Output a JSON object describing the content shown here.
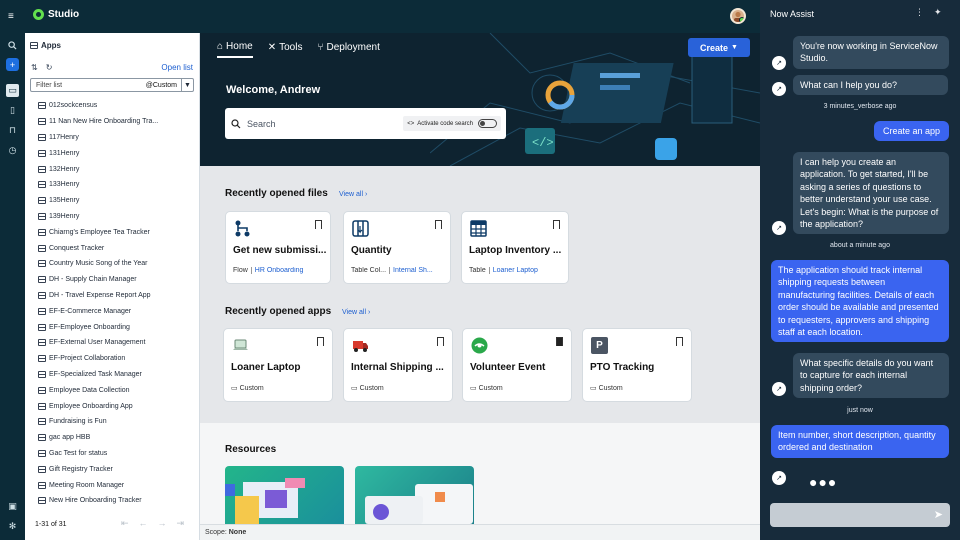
{
  "app": {
    "title": "Studio"
  },
  "panel": {
    "header": "Apps",
    "open_list": "Open list",
    "filter_placeholder": "Filter list",
    "filter_chip": "@Custom",
    "items": [
      "012sockcensus",
      "11 Nan New Hire Onboarding Tra...",
      "117Henry",
      "131Henry",
      "132Henry",
      "133Henry",
      "135Henry",
      "139Henry",
      "Chiarng's Employee Tea Tracker",
      "Conquest Tracker",
      "Country Music Song of the Year",
      "DH - Supply Chain Manager",
      "DH - Travel Expense Report App",
      "EF-E-Commerce Manager",
      "EF-Employee Onboarding",
      "EF-External User Management",
      "EF-Project Collaboration",
      "EF-Specialized Task Manager",
      "Employee Data Collection",
      "Employee Onboarding App",
      "Fundraising is Fun",
      "gac app HBB",
      "Gac Test for status",
      "Gift Registry Tracker",
      "Meeting Room Manager",
      "New Hire Onboarding Tracker"
    ],
    "pager": "1-31 of 31"
  },
  "nav": {
    "tabs": [
      "Home",
      "Tools",
      "Deployment"
    ],
    "create": "Create"
  },
  "hero": {
    "welcome": "Welcome, Andrew",
    "search_placeholder": "Search",
    "code_search": "Activate code search"
  },
  "files": {
    "title": "Recently opened files",
    "view_all": "View all",
    "cards": [
      {
        "title": "Get new submissi...",
        "type": "Flow",
        "link": "HR Onboarding"
      },
      {
        "title": "Quantity",
        "type": "Table Col...",
        "link": "Internal Sh..."
      },
      {
        "title": "Laptop Inventory ...",
        "type": "Table",
        "link": "Loaner Laptop"
      }
    ]
  },
  "apps": {
    "title": "Recently opened apps",
    "view_all": "View all",
    "cards": [
      {
        "title": "Loaner Laptop",
        "type": "Custom"
      },
      {
        "title": "Internal Shipping ...",
        "type": "Custom"
      },
      {
        "title": "Volunteer Event",
        "type": "Custom"
      },
      {
        "title": "PTO Tracking",
        "type": "Custom",
        "icon_letter": "P"
      }
    ]
  },
  "resources": {
    "title": "Resources"
  },
  "scope": {
    "label": "Scope:",
    "value": "None"
  },
  "assist": {
    "title": "Now Assist",
    "messages": [
      {
        "role": "bot",
        "text": "You're now working in ServiceNow Studio."
      },
      {
        "role": "bot",
        "text": "What can I help you do?"
      },
      {
        "role": "time",
        "text": "3 minutes_verbose ago"
      },
      {
        "role": "user",
        "text": "Create an app"
      },
      {
        "role": "bot",
        "text": "I can help you create an application. To get started, I'll be asking a series of questions to better understand your use case. Let's begin: What is the purpose of the application?"
      },
      {
        "role": "time",
        "text": "about a minute ago"
      },
      {
        "role": "user",
        "text": "The application should track internal shipping requests between manufacturing facilities. Details of each order should be available and presented to requesters, approvers and shipping staff at each location."
      },
      {
        "role": "bot",
        "text": "What specific details do you want to capture for each internal shipping order?"
      },
      {
        "role": "time",
        "text": "just now"
      },
      {
        "role": "user",
        "text": "Item number, short description, quantity ordered and destination"
      }
    ],
    "typing": "●●●"
  },
  "colors": {
    "accent": "#2962d9",
    "dark": "#0c2b38",
    "user_bubble": "#3a64f0",
    "bot_bubble": "#334a5d",
    "brand_green": "#63df4e"
  }
}
